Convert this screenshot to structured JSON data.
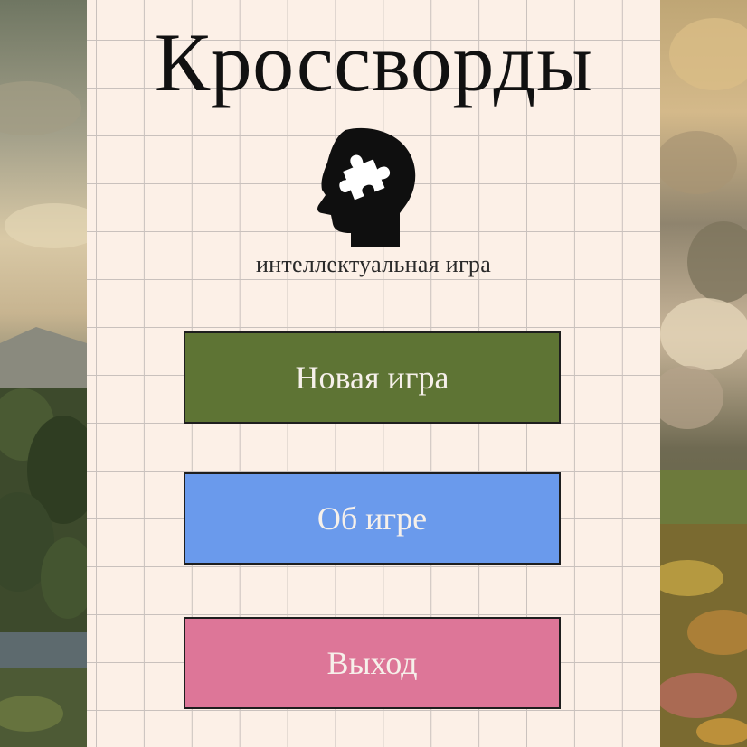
{
  "app": {
    "title": "Кроссворды",
    "subtitle": "интеллектуальная игра",
    "logo_icon": "head-puzzle-icon"
  },
  "menu": {
    "new_game_label": "Новая игра",
    "about_label": "Об игре",
    "exit_label": "Выход"
  },
  "colors": {
    "paper": "#fcf0e7",
    "grid_line": "#c9c1bd",
    "new_game_bg": "#5e7434",
    "about_bg": "#6a9aec",
    "exit_bg": "#dd7698",
    "button_text": "#f6f0ea"
  }
}
